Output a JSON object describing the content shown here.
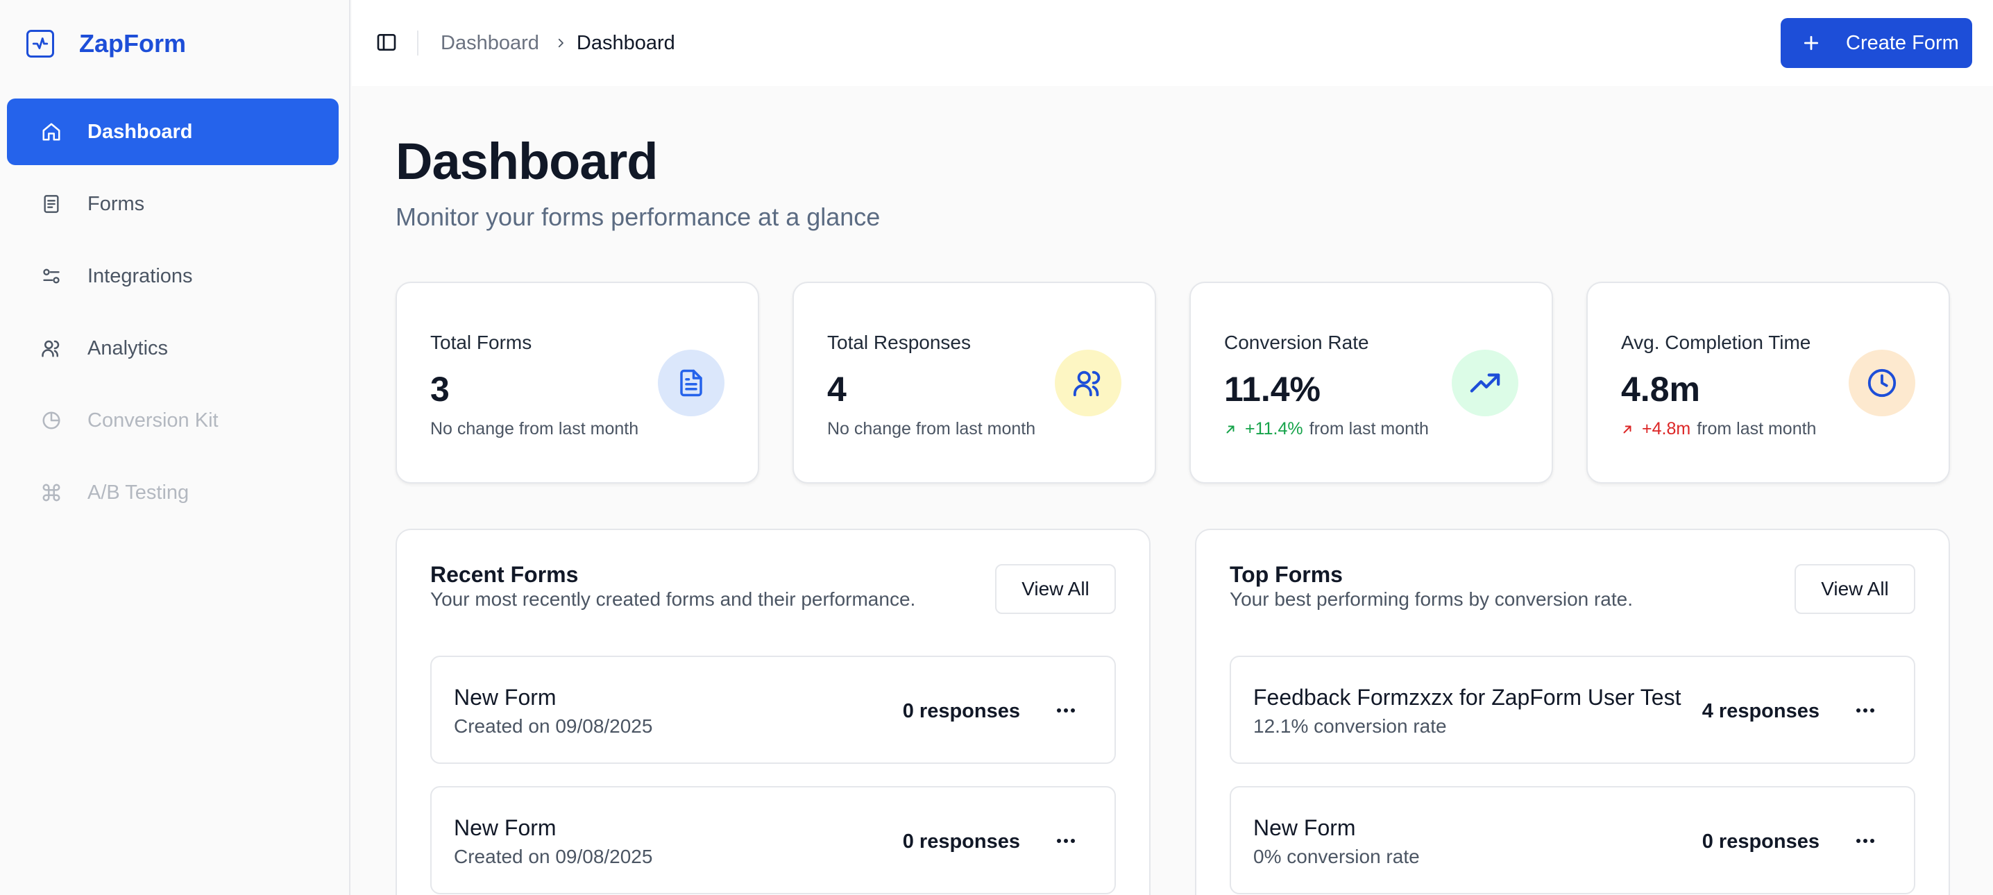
{
  "app": {
    "name": "ZapForm"
  },
  "sidebar": {
    "items": [
      {
        "label": "Dashboard",
        "icon": "home-icon",
        "active": true
      },
      {
        "label": "Forms",
        "icon": "file-icon"
      },
      {
        "label": "Integrations",
        "icon": "sliders-icon"
      },
      {
        "label": "Analytics",
        "icon": "users-icon"
      },
      {
        "label": "Conversion Kit",
        "icon": "pie-chart-icon",
        "disabled": true
      },
      {
        "label": "A/B Testing",
        "icon": "command-icon",
        "disabled": true
      }
    ]
  },
  "header": {
    "breadcrumb": [
      "Dashboard",
      "Dashboard"
    ],
    "create_label": "Create Form"
  },
  "page": {
    "title": "Dashboard",
    "subtitle": "Monitor your forms performance at a glance"
  },
  "stats": [
    {
      "label": "Total Forms",
      "value": "3",
      "note": "No change from last month",
      "icon": "file-text-icon",
      "icon_bg": "#dbe7fb",
      "icon_color": "#2563eb"
    },
    {
      "label": "Total Responses",
      "value": "4",
      "note": "No change from last month",
      "icon": "users-icon",
      "icon_bg": "#fdf6c3",
      "icon_color": "#1d4ed8"
    },
    {
      "label": "Conversion Rate",
      "value": "11.4%",
      "delta": "+11.4%",
      "note": "from last month",
      "delta_color": "#16a34a",
      "icon": "trending-up-icon",
      "icon_bg": "#dcfce7",
      "icon_color": "#1d4ed8"
    },
    {
      "label": "Avg. Completion Time",
      "value": "4.8m",
      "delta": "+4.8m",
      "note": "from last month",
      "delta_color": "#dc2626",
      "icon": "clock-icon",
      "icon_bg": "#fde9cf",
      "icon_color": "#1d4ed8"
    }
  ],
  "recent_forms": {
    "title": "Recent Forms",
    "subtitle": "Your most recently created forms and their performance.",
    "view_all": "View All",
    "items": [
      {
        "name": "New Form",
        "meta": "Created on 09/08/2025",
        "count": "0 responses"
      },
      {
        "name": "New Form",
        "meta": "Created on 09/08/2025",
        "count": "0 responses"
      }
    ]
  },
  "top_forms": {
    "title": "Top Forms",
    "subtitle": "Your best performing forms by conversion rate.",
    "view_all": "View All",
    "items": [
      {
        "name": "Feedback Formzxzx for ZapForm User Test",
        "meta": "12.1% conversion rate",
        "count": "4 responses"
      },
      {
        "name": "New Form",
        "meta": "0% conversion rate",
        "count": "0 responses"
      }
    ]
  },
  "colors": {
    "accent": "#2563eb",
    "brand": "#1d4ed8"
  }
}
